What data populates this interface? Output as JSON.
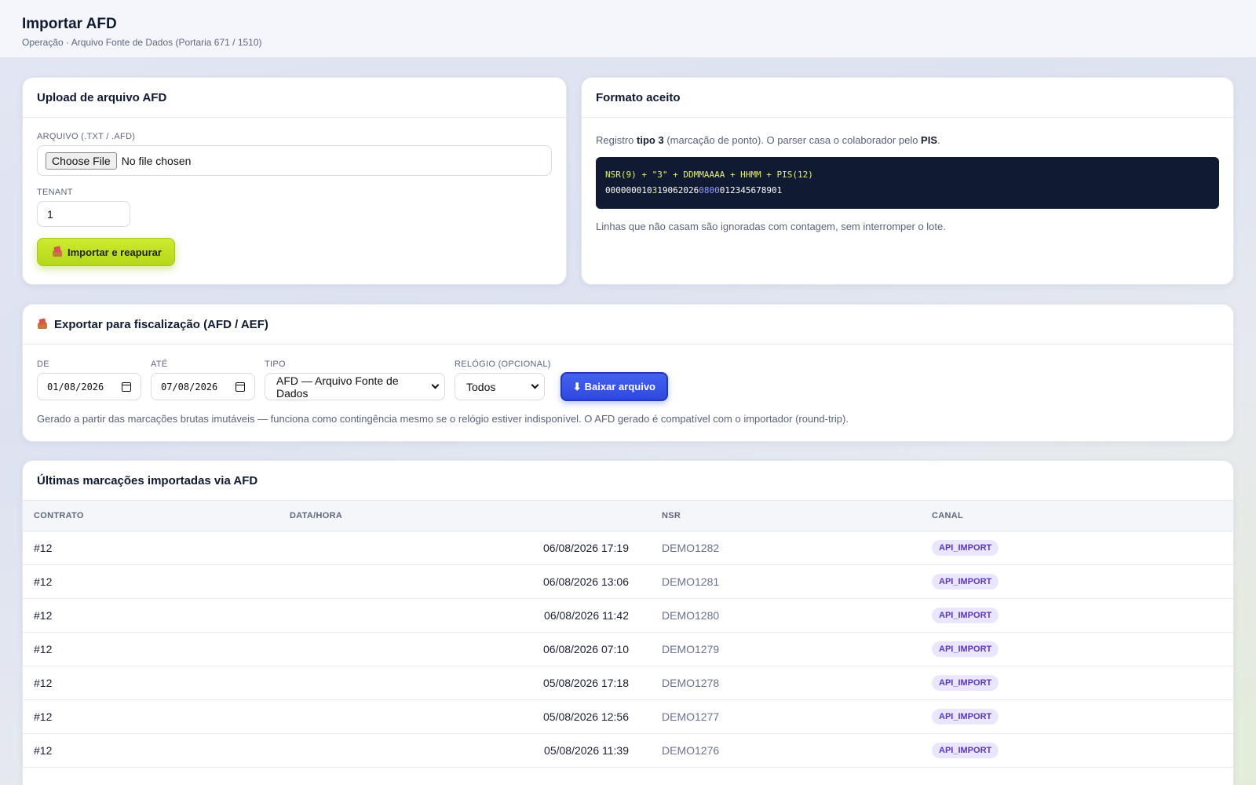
{
  "header": {
    "title": "Importar AFD",
    "subtitle": "Operação · Arquivo Fonte de Dados (Portaria 671 / 1510)"
  },
  "upload": {
    "title": "Upload de arquivo AFD",
    "file_label": "ARQUIVO (.TXT / .AFD)",
    "file_button": "Choose File",
    "file_status": "No file chosen",
    "tenant_label": "TENANT",
    "tenant_value": "1",
    "import_button": "Importar e reapurar",
    "import_icon": "box-icon"
  },
  "format": {
    "title": "Formato aceito",
    "intro_pre": "Registro ",
    "intro_bold1": "tipo 3",
    "intro_mid": " (marcação de ponto). O parser casa o colaborador pelo ",
    "intro_bold2": "PIS",
    "intro_post": ".",
    "code_format": "NSR(9) + \"3\" + DDMMAAAA + HHMM + PIS(12)",
    "code_sample_nsr": "000000010",
    "code_sample_type": "3",
    "code_sample_date": "19062026",
    "code_sample_time": "0800",
    "code_sample_pis": "012345678901",
    "note": "Linhas que não casam são ignoradas com contagem, sem interromper o lote."
  },
  "export": {
    "title": "Exportar para fiscalização (AFD / AEF)",
    "icon": "box-icon",
    "from_label": "DE",
    "from_value": "01/08/2026",
    "to_label": "ATÉ",
    "to_value": "07/08/2026",
    "type_label": "TIPO",
    "type_value": "AFD — Arquivo Fonte de Dados",
    "clock_label": "RELÓGIO (OPCIONAL)",
    "clock_value": "Todos",
    "download_button": "Baixar arquivo",
    "download_icon": "⬇",
    "note": "Gerado a partir das marcações brutas imutáveis — funciona como contingência mesmo se o relógio estiver indisponível. O AFD gerado é compatível com o importador (round-trip)."
  },
  "recent": {
    "title": "Últimas marcações importadas via AFD",
    "columns": {
      "contract": "CONTRATO",
      "datetime": "DATA/HORA",
      "nsr": "NSR",
      "channel": "CANAL"
    },
    "rows": [
      {
        "contract": "#12",
        "datetime": "06/08/2026 17:19",
        "nsr": "DEMO1282",
        "channel": "API_IMPORT"
      },
      {
        "contract": "#12",
        "datetime": "06/08/2026 13:06",
        "nsr": "DEMO1281",
        "channel": "API_IMPORT"
      },
      {
        "contract": "#12",
        "datetime": "06/08/2026 11:42",
        "nsr": "DEMO1280",
        "channel": "API_IMPORT"
      },
      {
        "contract": "#12",
        "datetime": "06/08/2026 07:10",
        "nsr": "DEMO1279",
        "channel": "API_IMPORT"
      },
      {
        "contract": "#12",
        "datetime": "05/08/2026 17:18",
        "nsr": "DEMO1278",
        "channel": "API_IMPORT"
      },
      {
        "contract": "#12",
        "datetime": "05/08/2026 12:56",
        "nsr": "DEMO1277",
        "channel": "API_IMPORT"
      },
      {
        "contract": "#12",
        "datetime": "05/08/2026 11:39",
        "nsr": "DEMO1276",
        "channel": "API_IMPORT"
      }
    ]
  },
  "colors": {
    "accent_lime": "#c2e024",
    "accent_blue": "#3550e8",
    "badge_bg": "#ebe6ff",
    "badge_text": "#5a36c7",
    "code_bg": "#111a33"
  }
}
